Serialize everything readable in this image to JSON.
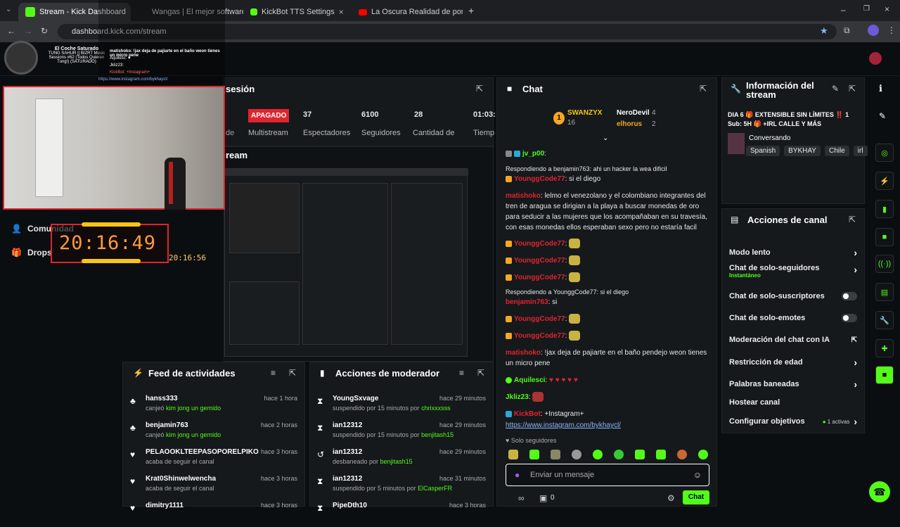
{
  "browser": {
    "tabs": [
      {
        "label": "Stream - Kick Dashboard",
        "color": "#53fc18"
      },
      {
        "label": "Wangas | El mejor software pa",
        "color": "#444"
      },
      {
        "label": "KickBot TTS Settings",
        "color": "#53fc18"
      },
      {
        "label": "La Oscura Realidad de por qué",
        "color": "#ff0000"
      }
    ],
    "url": "dashboard.kick.com/stream"
  },
  "overlay": {
    "now_playing_title": "El Coche Saturado",
    "now_playing_sub": "TUNG SAHUR || BIZRT Music Sessions #62 (Todos Quieren Tung!) (SATURADO)",
    "clock_big": "20:16:49",
    "clock_small": "20:16:56",
    "mini_chat": [
      "-: si",
      "Aquilesc: ♥",
      "Jkliz23:",
      "KickBot: +Instagram+",
      "https://www.instagram.com/bykhaycl/",
      "YounggCode77:",
      "matishoko: !jax deja de pajiarte en el baño weon tienes un micro pene"
    ]
  },
  "sidebar": {
    "comunidad": "Comunidad",
    "drops": "Drops"
  },
  "session": {
    "title": "sesión",
    "stats": [
      {
        "value": "APAGADO",
        "label": "Multistream"
      },
      {
        "value": "37",
        "label": "Espectadores"
      },
      {
        "value": "6100",
        "label": "Seguidores"
      },
      {
        "value": "28",
        "label": "Cantidad de"
      },
      {
        "value": "01:03:",
        "label": "Tiemp"
      }
    ],
    "partial_label": "de",
    "stream_label": "ream"
  },
  "chat": {
    "title": "Chat",
    "leaderboard": {
      "first": {
        "name": "SWANZYX",
        "count": "16"
      },
      "second": {
        "name": "NeroDevil",
        "count": "4"
      },
      "third": {
        "name": "elhorus",
        "count": "2"
      }
    },
    "messages": [
      {
        "user": "jv_p00",
        "text": ":",
        "color": "g"
      },
      {
        "reply": "Respondiendo a benjamin763: ahi un hacker la wea dificil"
      },
      {
        "user": "YounggCode77",
        "text": ": si el diego",
        "color": "r"
      },
      {
        "user": "matishoko",
        "text": ": lelmo el venezolano y el colombiano integrantes del tren de aragua se dirigian a la playa a buscar monedas de oro para seducir a las mujeres que los acompañaban en su travesía, con esas monedas ellos esperaban sexo pero no estaría facil",
        "color": "r"
      },
      {
        "user": "YounggCode77",
        "text": ":",
        "color": "r"
      },
      {
        "user": "YounggCode77",
        "text": ":",
        "color": "r"
      },
      {
        "user": "YounggCode77",
        "text": ":",
        "color": "r"
      },
      {
        "reply": "Respondiendo a YounggCode77: si el diego"
      },
      {
        "user": "benjamin763",
        "text": ": si",
        "color": "r"
      },
      {
        "user": "YounggCode77",
        "text": ":",
        "color": "r"
      },
      {
        "user": "YounggCode77",
        "text": ":",
        "color": "r"
      },
      {
        "user": "matishoko",
        "text": ": !jax deja de pajiarte en el baño pendejo weon tienes un micro pene",
        "color": "r"
      },
      {
        "user": "Aquilesci",
        "text": ":",
        "color": "g"
      },
      {
        "user": "Jkliz23",
        "text": ":",
        "color": "g"
      },
      {
        "user": "KickBot",
        "text": ": +Instagram+",
        "color": "r"
      },
      {
        "link": "https://www.instagram.com/bykhaycl/"
      }
    ],
    "mode": "Solo seguidores",
    "input_placeholder": "Enviar un mensaje",
    "points": "0",
    "send_label": "Chat"
  },
  "stream_info": {
    "title": "Información del stream",
    "stream_title": "DIA 6 🎁 EXTENSIBLE SIN LÍMITES ‼️ 1 Sub: 5H 🎁 +IRL CALLE Y MÁS",
    "category": "Conversando",
    "tags": [
      "Spanish",
      "BYKHAY",
      "Chile",
      "irl"
    ]
  },
  "channel_actions": {
    "title": "Acciones de canal",
    "items": [
      {
        "label": "Modo lento",
        "type": "chev"
      },
      {
        "label": "Chat de solo-seguidores",
        "sub": "Instantáneo",
        "type": "chev"
      },
      {
        "label": "Chat de solo-suscriptores",
        "type": "toggle"
      },
      {
        "label": "Chat de solo-emotes",
        "type": "toggle"
      },
      {
        "label": "Moderación del chat con IA",
        "type": "ext"
      },
      {
        "label": "Restricción de edad",
        "type": "chev"
      },
      {
        "label": "Palabras baneadas",
        "type": "chev"
      },
      {
        "label": "Hostear canal",
        "type": "none"
      },
      {
        "label": "Configurar objetivos",
        "sub2": "1 activas",
        "type": "chev"
      }
    ]
  },
  "activity_feed": {
    "title": "Feed de actividades",
    "items": [
      {
        "name": "hanss333",
        "desc_pre": "canjeó ",
        "desc_hl": "kim jong un gemido",
        "time": "hace 1 hora",
        "icon": "♣"
      },
      {
        "name": "benjamin763",
        "desc_pre": "canjeó ",
        "desc_hl": "kim jong un gemido",
        "time": "hace 2 horas",
        "icon": "♣"
      },
      {
        "name": "PELAOOKLTEEPASOPORELPIKO",
        "desc_pre": "acaba de seguir el canal",
        "desc_hl": "",
        "time": "hace 3 horas",
        "icon": "♥"
      },
      {
        "name": "Krat0Shinwelwencha",
        "desc_pre": "acaba de seguir el canal",
        "desc_hl": "",
        "time": "hace 3 horas",
        "icon": "♥"
      },
      {
        "name": "dimitry1111",
        "desc_pre": "",
        "desc_hl": "",
        "time": "hace 3 horas",
        "icon": "♥"
      }
    ]
  },
  "mod_actions": {
    "title": "Acciones de moderador",
    "items": [
      {
        "name": "YoungSxvage",
        "desc_pre": "suspendido por 15 minutos por ",
        "desc_hl": "chrixxxsss",
        "time": "hace 29 minutos",
        "icon": "⧗"
      },
      {
        "name": "ian12312",
        "desc_pre": "suspendido por 15 minutos por ",
        "desc_hl": "benjitash15",
        "time": "hace 29 minutos",
        "icon": "⧗"
      },
      {
        "name": "ian12312",
        "desc_pre": "desbaneado por ",
        "desc_hl": "benjitash15",
        "time": "hace 29 minutos",
        "icon": "↺"
      },
      {
        "name": "ian12312",
        "desc_pre": "suspendido por 5 minutos por ",
        "desc_hl": "ElCasperFR",
        "time": "hace 31 minutos",
        "icon": "⧗"
      },
      {
        "name": "PipeDth10",
        "desc_pre": "",
        "desc_hl": "",
        "time": "hace 3 horas",
        "icon": "⧗"
      }
    ]
  }
}
